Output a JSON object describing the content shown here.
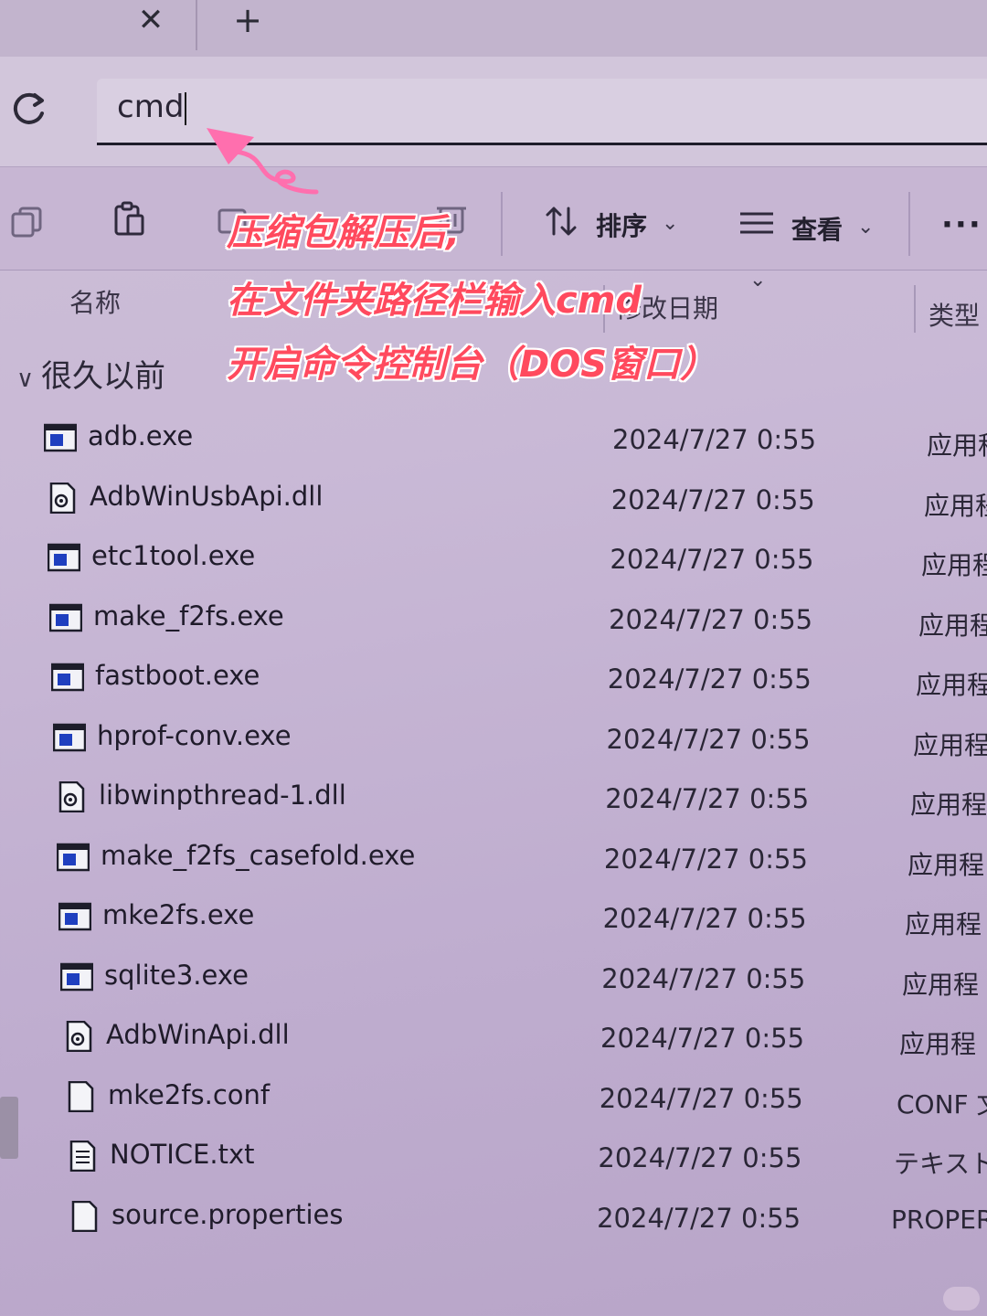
{
  "tabbar": {
    "close_glyph": "✕",
    "add_glyph": "+"
  },
  "address": {
    "value": "cmd"
  },
  "toolbar": {
    "sort_label": "排序",
    "view_label": "查看",
    "more_label": "···"
  },
  "columns": {
    "name": "名称",
    "modified": "修改日期",
    "type": "类型"
  },
  "group": {
    "label": "很久以前"
  },
  "annotation": {
    "lines": [
      "压缩包解压后,",
      "在文件夹路径栏输入cmd",
      "开启命令控制台（DOS窗口）"
    ],
    "color": "#ff4a5e"
  },
  "files": [
    {
      "name": "adb.exe",
      "date": "2024/7/27 0:55",
      "type": "应用程",
      "icon": "exe-icon"
    },
    {
      "name": "AdbWinUsbApi.dll",
      "date": "2024/7/27 0:55",
      "type": "应用程",
      "icon": "dll-icon"
    },
    {
      "name": "etc1tool.exe",
      "date": "2024/7/27 0:55",
      "type": "应用程",
      "icon": "exe-icon"
    },
    {
      "name": "make_f2fs.exe",
      "date": "2024/7/27 0:55",
      "type": "应用程",
      "icon": "exe-icon"
    },
    {
      "name": "fastboot.exe",
      "date": "2024/7/27 0:55",
      "type": "应用程",
      "icon": "exe-icon"
    },
    {
      "name": "hprof-conv.exe",
      "date": "2024/7/27 0:55",
      "type": "应用程",
      "icon": "exe-icon"
    },
    {
      "name": "libwinpthread-1.dll",
      "date": "2024/7/27 0:55",
      "type": "应用程",
      "icon": "dll-icon"
    },
    {
      "name": "make_f2fs_casefold.exe",
      "date": "2024/7/27 0:55",
      "type": "应用程",
      "icon": "exe-icon"
    },
    {
      "name": "mke2fs.exe",
      "date": "2024/7/27 0:55",
      "type": "应用程",
      "icon": "exe-icon"
    },
    {
      "name": "sqlite3.exe",
      "date": "2024/7/27 0:55",
      "type": "应用程",
      "icon": "exe-icon"
    },
    {
      "name": "AdbWinApi.dll",
      "date": "2024/7/27 0:55",
      "type": "应用程",
      "icon": "dll-icon"
    },
    {
      "name": "mke2fs.conf",
      "date": "2024/7/27 0:55",
      "type": "CONF 文",
      "icon": "file-icon"
    },
    {
      "name": "NOTICE.txt",
      "date": "2024/7/27 0:55",
      "type": "テキスト",
      "icon": "text-file-icon"
    },
    {
      "name": "source.properties",
      "date": "2024/7/27 0:55",
      "type": "PROPER",
      "icon": "file-icon"
    }
  ]
}
